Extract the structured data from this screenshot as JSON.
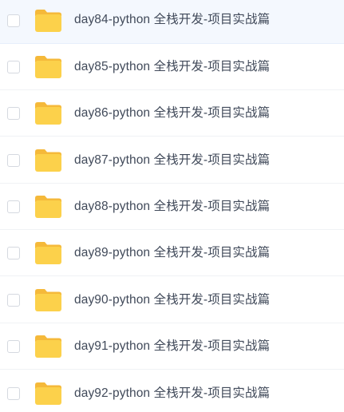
{
  "file_list": {
    "items": [
      {
        "name": "day84-python 全栈开发-项目实战篇",
        "type": "folder-icon",
        "highlighted": true
      },
      {
        "name": "day85-python 全栈开发-项目实战篇",
        "type": "folder-icon",
        "highlighted": false
      },
      {
        "name": "day86-python 全栈开发-项目实战篇",
        "type": "folder-icon",
        "highlighted": false
      },
      {
        "name": "day87-python 全栈开发-项目实战篇",
        "type": "folder-icon",
        "highlighted": false
      },
      {
        "name": "day88-python 全栈开发-项目实战篇",
        "type": "folder-icon",
        "highlighted": false
      },
      {
        "name": "day89-python 全栈开发-项目实战篇",
        "type": "folder-icon",
        "highlighted": false
      },
      {
        "name": "day90-python 全栈开发-项目实战篇",
        "type": "folder-icon",
        "highlighted": false
      },
      {
        "name": "day91-python 全栈开发-项目实战篇",
        "type": "folder-icon",
        "highlighted": false
      },
      {
        "name": "day92-python 全栈开发-项目实战篇",
        "type": "folder-icon",
        "highlighted": false
      }
    ]
  },
  "colors": {
    "folder_front": "#fcd14b",
    "folder_back": "#f5b93a",
    "text": "#414a5a",
    "highlight_bg": "#f4f8fe"
  }
}
